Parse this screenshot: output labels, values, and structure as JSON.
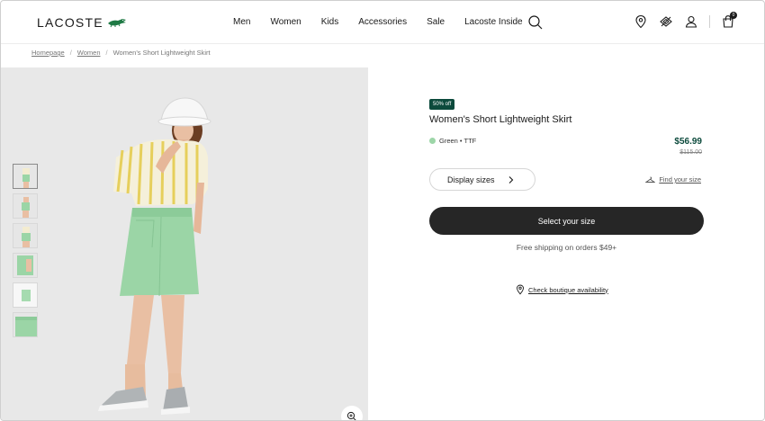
{
  "header": {
    "logo_text": "LACOSTE",
    "nav": [
      "Men",
      "Women",
      "Kids",
      "Accessories",
      "Sale",
      "Lacoste Inside"
    ],
    "cart_count": "0"
  },
  "breadcrumb": {
    "home": "Homepage",
    "women": "Women",
    "current": "Women's Short Lightweight Skirt",
    "separator": "/"
  },
  "product": {
    "badge": "50% off",
    "title": "Women's Short Lightweight Skirt",
    "color_name": "Green • TTF",
    "color_hex": "#9dd6a8",
    "price_now": "$56.99",
    "price_old": "$115.00",
    "display_sizes_label": "Display sizes",
    "find_size_label": "Find your size",
    "select_size_label": "Select your size",
    "shipping_text": "Free shipping on orders $49+",
    "boutique_label": "Check boutique availability"
  },
  "colors": {
    "brand_green": "#0c4a3c",
    "button_dark": "#262626"
  },
  "icons": [
    "lacoste-crocodile-icon",
    "search-icon",
    "location-pin-icon",
    "gift-icon",
    "account-icon",
    "cart-icon",
    "chevron-right-icon",
    "hanger-icon",
    "zoom-icon"
  ]
}
